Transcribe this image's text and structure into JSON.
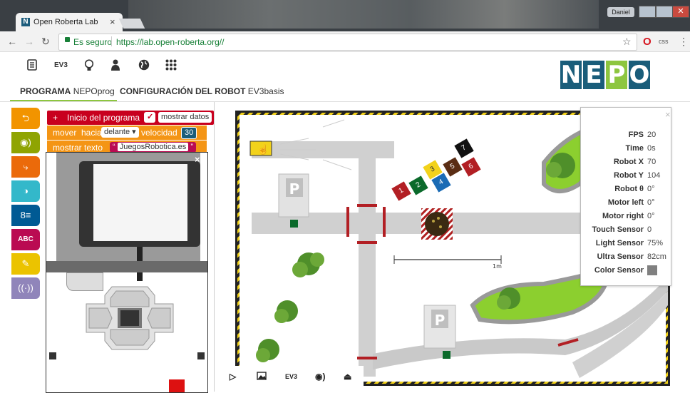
{
  "browser": {
    "tab_title": "Open Roberta Lab",
    "tab_close": "×",
    "user_name": "Daniel",
    "secure_label": "Es seguro",
    "url": "https://lab.open-roberta.org//",
    "extension_label": "css"
  },
  "app": {
    "robot_label": "EV3",
    "logo_letters": [
      "N",
      "E",
      "P",
      "O"
    ],
    "logo_colors": [
      "#1a5d7a",
      "#1a5d7a",
      "#8dc63f",
      "#1a5d7a"
    ],
    "tabs": {
      "program_bold": "PROGRAMA",
      "program_name": "NEPOprog",
      "config_bold": "CONFIGURACIÓN DEL ROBOT",
      "config_name": "EV3basis"
    }
  },
  "toolbox": {
    "categories": [
      {
        "icon": "action-icon",
        "color": "#f29400"
      },
      {
        "icon": "sensor-icon",
        "color": "#8fa402"
      },
      {
        "icon": "control-icon",
        "color": "#eb6a0a"
      },
      {
        "icon": "logic-icon",
        "color": "#33b8ca"
      },
      {
        "icon": "math-icon",
        "color": "#005a94"
      },
      {
        "icon": "text-icon",
        "color": "#ba0b52"
      },
      {
        "icon": "color-icon",
        "color": "#ebc300"
      },
      {
        "icon": "messages-icon",
        "color": "#9085ba"
      }
    ],
    "text_label": "ABC"
  },
  "blocks": {
    "start": "Inicio del programa",
    "show_data": "mostrar datos",
    "drive": "mover",
    "drive_dir_label": "hacia",
    "drive_dir": "delante",
    "speed_label": "velocidad",
    "speed_value": "30",
    "show_text": "mostrar texto",
    "text_value": "JuegosRobotica.es"
  },
  "simulator": {
    "scale_label": "1m",
    "parking_label": "P",
    "toolbar": {
      "play": "▷",
      "image": "image",
      "ev3": "EV3",
      "sound": "sound",
      "upload": "upload"
    },
    "blocks_numbers": [
      "1",
      "2",
      "3",
      "4",
      "5",
      "6",
      "7"
    ]
  },
  "sensor_panel": {
    "close": "×",
    "rows": [
      {
        "label": "FPS",
        "value": "20"
      },
      {
        "label": "Time",
        "value": "0s"
      },
      {
        "label": "Robot X",
        "value": "70"
      },
      {
        "label": "Robot Y",
        "value": "104"
      },
      {
        "label": "Robot θ",
        "value": "0°"
      },
      {
        "label": "Motor left",
        "value": "0°"
      },
      {
        "label": "Motor right",
        "value": "0°"
      },
      {
        "label": "Touch Sensor",
        "value": "0"
      },
      {
        "label": "Light Sensor",
        "value": "75%"
      },
      {
        "label": "Ultra Sensor",
        "value": "82cm"
      },
      {
        "label": "Color Sensor",
        "value": ""
      }
    ],
    "color_sensor_swatch": "#808080"
  }
}
